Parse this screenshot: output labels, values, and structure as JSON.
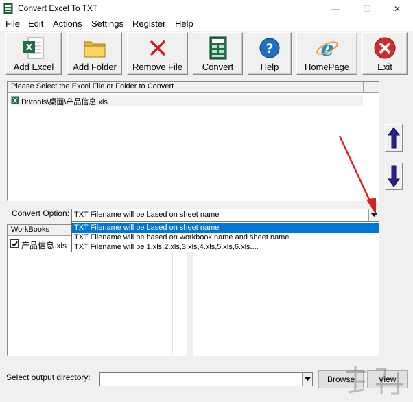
{
  "window": {
    "title": "Convert Excel To TXT",
    "minimize": "—",
    "maximize": "☐",
    "close": "✕"
  },
  "menu": [
    "File",
    "Edit",
    "Actions",
    "Settings",
    "Register",
    "Help"
  ],
  "toolbar": {
    "add_excel": "Add Excel",
    "add_folder": "Add Folder",
    "remove_file": "Remove File",
    "convert": "Convert",
    "help": "Help",
    "homepage": "HomePage",
    "exit": "Exit"
  },
  "file_list": {
    "header": "Please Select the Excel File or Folder to Convert",
    "items": [
      "D:\\tools\\桌面\\产品信息.xls"
    ]
  },
  "convert_option": {
    "label": "Convert Option:",
    "selected": "TXT Filename will be based on sheet name",
    "options": [
      "TXT Filename will be based on sheet name",
      "TXT Filename will be based on workbook name and sheet name",
      "TXT Filename will be 1.xls,2.xls,3.xls,4.xls,5.xls,6.xls...."
    ]
  },
  "workbooks": {
    "header": "WorkBooks",
    "items": [
      {
        "name": "产品信息.xls",
        "checked": true
      }
    ]
  },
  "output": {
    "label": "Select  output directory:",
    "value": "",
    "browse": "Browse",
    "view": "View"
  },
  "colors": {
    "arrow_up": "#2a1f8f",
    "arrow_down": "#2a1f8f",
    "selection": "#0078d7",
    "annotation": "#d42020"
  }
}
